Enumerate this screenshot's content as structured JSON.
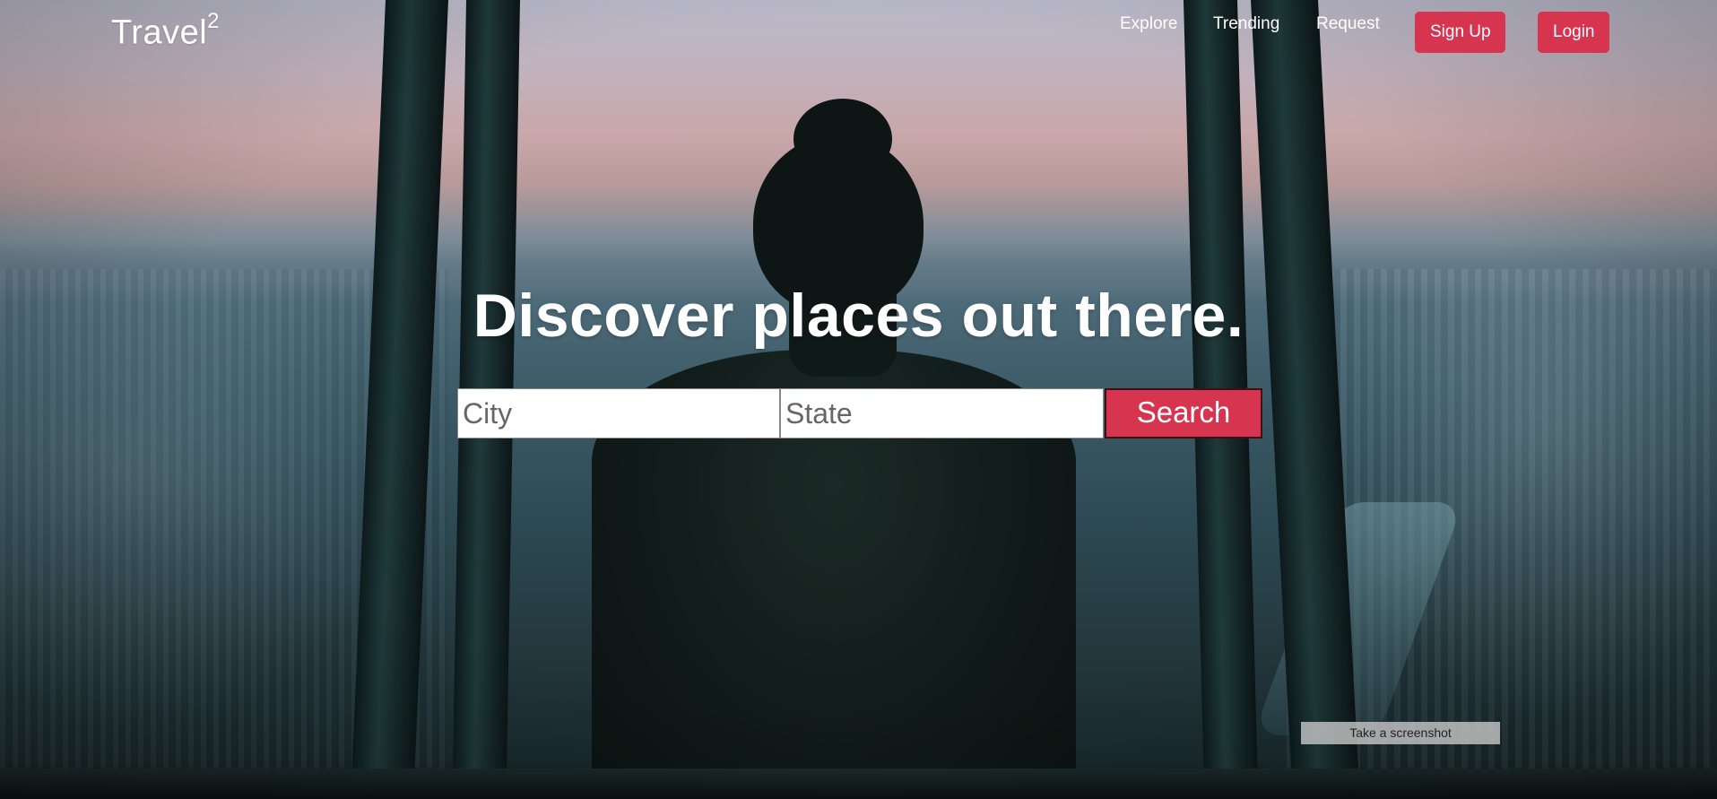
{
  "brand": {
    "name": "Travel",
    "superscript": "2"
  },
  "nav": {
    "links": [
      "Explore",
      "Trending",
      "Request"
    ],
    "signup_label": "Sign Up",
    "login_label": "Login"
  },
  "hero": {
    "headline": "Discover places out there.",
    "background_icon": "city-skyline-photo"
  },
  "search": {
    "city_placeholder": "City",
    "state_placeholder": "State",
    "button_label": "Search"
  },
  "overlay": {
    "screenshot_label": "Take a screenshot"
  },
  "colors": {
    "accent": "#d7354f",
    "text": "#ffffff"
  }
}
